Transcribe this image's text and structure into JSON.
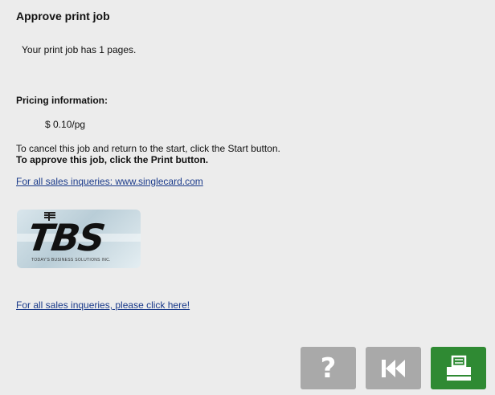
{
  "page": {
    "title": "Approve print job",
    "pages_text": "Your print job has 1 pages.",
    "pricing_heading": "Pricing information:",
    "price": "$ 0.10/pg",
    "cancel_instruction": "To cancel this job and return to the start, click the Start button.",
    "approve_instruction": "To approve this job, click the Print button.",
    "sales_link_1": "For all sales inqueries: www.singlecard.com",
    "sales_link_2": "For all sales inqueries, please click here!"
  },
  "logo": {
    "text": "TBS",
    "tagline": "TODAY'S BUSINESS SOLUTIONS INC."
  },
  "buttons": {
    "help_icon": "question-mark-icon",
    "start_icon": "skip-back-icon",
    "print_icon": "printer-icon"
  },
  "colors": {
    "background": "#ececec",
    "link": "#1a3a8a",
    "button_gray": "#a9a9a9",
    "button_green": "#2f8a33"
  }
}
